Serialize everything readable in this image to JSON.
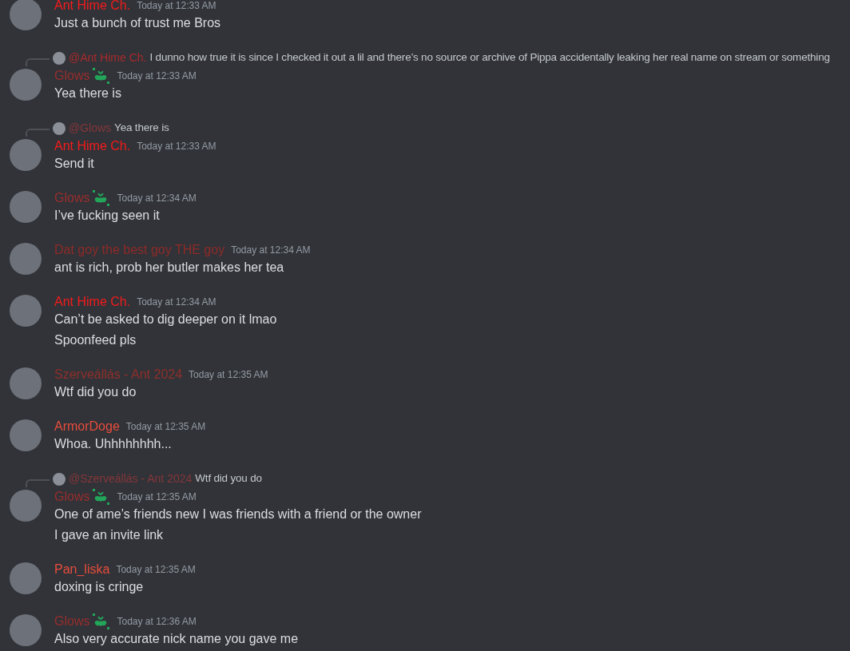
{
  "messages": [
    {
      "author": "Ant Hime Ch.",
      "color": "#f41b1b",
      "badge": false,
      "timestamp": "Today at 12:33 AM",
      "lines": [
        "Just a bunch of trust me Bros"
      ]
    },
    {
      "reply": {
        "author": "@Ant Hime Ch.",
        "color": "#a72a2c",
        "text": "I dunno how true it is since I checked it out a lil and there’s no source or archive of Pippa accidentally leaking her real name on stream or something"
      },
      "author": "Glows",
      "color": "#992d2d",
      "badge": true,
      "timestamp": "Today at 12:33 AM",
      "lines": [
        "Yea there is"
      ]
    },
    {
      "reply": {
        "author": "@Glows",
        "color": "#85363a",
        "text": "Yea there is"
      },
      "author": "Ant Hime Ch.",
      "color": "#f41b1b",
      "badge": false,
      "timestamp": "Today at 12:33 AM",
      "lines": [
        "Send it"
      ]
    },
    {
      "author": "Glows",
      "color": "#992d2d",
      "badge": true,
      "timestamp": "Today at 12:34 AM",
      "lines": [
        "I’ve fucking seen it"
      ]
    },
    {
      "author": "Dat goy the best goy THE goy",
      "color": "#8f2a28",
      "badge": false,
      "timestamp": "Today at 12:34 AM",
      "lines": [
        "ant is rich, prob her butler makes her tea"
      ]
    },
    {
      "author": "Ant Hime Ch.",
      "color": "#f41b1b",
      "badge": false,
      "timestamp": "Today at 12:34 AM",
      "lines": [
        "Can’t be asked to dig deeper on it lmao",
        "Spoonfeed pls"
      ]
    },
    {
      "author": "Szerveállás - Ant 2024",
      "color": "#8f2f2b",
      "badge": false,
      "timestamp": "Today at 12:35 AM",
      "lines": [
        "Wtf did you do"
      ]
    },
    {
      "author": "ArmorDoge",
      "color": "#e74c3c",
      "badge": false,
      "timestamp": "Today at 12:35 AM",
      "lines": [
        "Whoa. Uhhhhhhhh..."
      ]
    },
    {
      "reply": {
        "author": "@Szerveállás - Ant 2024",
        "color": "#85363a",
        "text": "Wtf did you do"
      },
      "author": "Glows",
      "color": "#992d2d",
      "badge": true,
      "timestamp": "Today at 12:35 AM",
      "lines": [
        "One of ame’s friends new I was friends with a friend or the owner",
        "I gave an invite link"
      ]
    },
    {
      "author": "Pan_liska",
      "color": "#e74c3c",
      "badge": false,
      "timestamp": "Today at 12:35 AM",
      "lines": [
        "doxing is cringe"
      ]
    },
    {
      "author": "Glows",
      "color": "#992d2d",
      "badge": true,
      "timestamp": "Today at 12:36 AM",
      "lines": [
        "Also very accurate nick name you gave me"
      ]
    }
  ]
}
